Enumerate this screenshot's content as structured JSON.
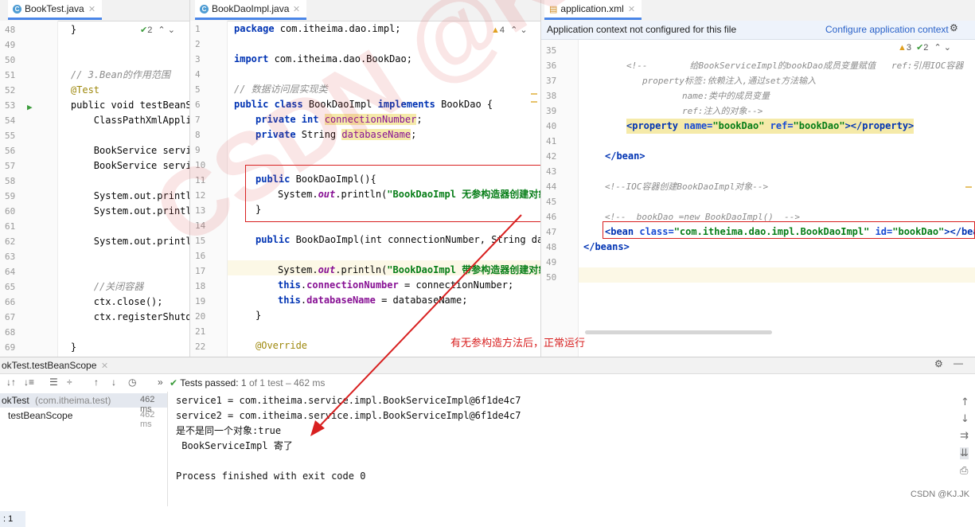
{
  "tabs": {
    "left": "BookTest.java",
    "mid": "BookDaoImpl.java",
    "right": "application.xml"
  },
  "left_editor": {
    "inspection": "2",
    "lines": [
      {
        "n": "48",
        "t": "    }"
      },
      {
        "n": "49",
        "t": ""
      },
      {
        "n": "50",
        "t": ""
      },
      {
        "n": "51",
        "t": "    // 3.Bean的作用范围"
      },
      {
        "n": "52",
        "t": "    @Test"
      },
      {
        "n": "53",
        "t": "    public void testBeanSc"
      },
      {
        "n": "54",
        "t": "        ClassPathXmlApplic"
      },
      {
        "n": "55",
        "t": ""
      },
      {
        "n": "56",
        "t": "        BookService servic"
      },
      {
        "n": "57",
        "t": "        BookService servic"
      },
      {
        "n": "58",
        "t": ""
      },
      {
        "n": "59",
        "t": "        System.out.printl"
      },
      {
        "n": "60",
        "t": "        System.out.printl"
      },
      {
        "n": "61",
        "t": ""
      },
      {
        "n": "62",
        "t": "        System.out.printl"
      },
      {
        "n": "63",
        "t": ""
      },
      {
        "n": "64",
        "t": ""
      },
      {
        "n": "65",
        "t": "        //关闭容器"
      },
      {
        "n": "66",
        "t": "        ctx.close();"
      },
      {
        "n": "67",
        "t": "        ctx.registerShutd"
      },
      {
        "n": "68",
        "t": ""
      },
      {
        "n": "69",
        "t": "    }"
      }
    ]
  },
  "mid_editor": {
    "warnings": "4",
    "pkg": "package com.itheima.dao.impl;",
    "import": "import com.itheima.dao.BookDao;",
    "comment": "// 数据访问层实现类",
    "class_decl": {
      "kw": "public class",
      "name": " BookDaoImpl ",
      "kw2": "implements",
      "rest": " BookDao {"
    },
    "field1": {
      "kw": "private int",
      "name": "connectionNumber",
      "end": ";"
    },
    "field2": {
      "kw": "private",
      "type": " String ",
      "name": "databaseName",
      "end": ";"
    },
    "ctor1": {
      "kw": "public",
      "rest": " BookDaoImpl(){"
    },
    "ctor1_body": {
      "pre": "System.",
      "out": "out",
      "mid": ".println(",
      "str": "\"BookDaoImpl 无参构造器创建对象\"",
      "end": ");"
    },
    "ctor1_close": "}",
    "ctor2": {
      "kw": "public",
      "rest": " BookDaoImpl(int connectionNumber, String databa"
    },
    "ctor2_body": {
      "pre": "System.",
      "out": "out",
      "mid": ".println(",
      "str": "\"BookDaoImpl 带参构造器创建对象\"",
      "end": ");"
    },
    "assign1": {
      "kw": "this",
      "dot": ".",
      "fld": "connectionNumber",
      "rest": " = connectionNumber;"
    },
    "assign2": {
      "kw": "this",
      "dot": ".",
      "fld": "databaseName",
      "rest": " = databaseName;"
    },
    "ctor2_close": "}",
    "override": "@Override",
    "line_numbers": [
      "1",
      "2",
      "3",
      "4",
      "5",
      "6",
      "7",
      "8",
      "9",
      "10",
      "11",
      "12",
      "13",
      "14",
      "15",
      "16",
      "17",
      "18",
      "19",
      "20",
      "21",
      "22"
    ]
  },
  "right_editor": {
    "banner_text": "Application context not configured for this file",
    "banner_link": "Configure application context",
    "warnings": "3",
    "checks": "2",
    "line_numbers": [
      "35",
      "36",
      "37",
      "38",
      "39",
      "40",
      "41",
      "42",
      "43",
      "44",
      "45",
      "46",
      "47",
      "48",
      "49",
      "50"
    ],
    "xml_comment1": "<!--        给BookServiceImpl的bookDao成员变量赋值   ref:引用IOC容器",
    "xml_comment2": "property标签:依赖注入,通过set方法输入",
    "xml_comment3": "name:类中的成员变量",
    "xml_comment4": "ref:注入的对象-->",
    "property_line": {
      "open": "<property",
      "a1": " name=",
      "v1": "\"bookDao\"",
      "a2": " ref=",
      "v2": "\"bookDao\"",
      "close": "></property>"
    },
    "bean_close": "</bean>",
    "ioc_comment": "<!--IOC容器创建BookDaoImpl对象-->",
    "new_comment": "<!--  bookDao =new BookDaoImpl()  -->",
    "bean_line": {
      "open": "<bean",
      "a1": " class=",
      "v1": "\"com.itheima.dao.impl.BookDaoImpl\"",
      "a2": " id=",
      "v2": "\"bookDao\"",
      "close": "></bean"
    },
    "beans_close": "</beans>"
  },
  "annotation": "有无参构造方法后，正常运行",
  "run_panel": {
    "title": "okTest.testBeanScope",
    "status_prefix": "Tests passed:",
    "status_count": "1",
    "status_rest": "of 1 test – 462 ms",
    "tree": [
      {
        "label": "okTest",
        "pkg": " (com.itheima.test)",
        "time": "462 ms"
      },
      {
        "label": "testBeanScope",
        "pkg": "",
        "time": "462 ms"
      }
    ],
    "console": [
      "service1 = com.itheima.service.impl.BookServiceImpl@6f1de4c7",
      "service2 = com.itheima.service.impl.BookServiceImpl@6f1de4c7",
      "是不是同一个对象:true",
      " BookServiceImpl 寄了",
      "",
      "Process finished with exit code 0"
    ],
    "side_label": ": 1"
  },
  "watermark": "CSDN @KJ.JK",
  "footer_watermark": "CSDN @KJ.JK",
  "colors": {
    "red": "#d82020",
    "accent": "#4a86e8"
  }
}
